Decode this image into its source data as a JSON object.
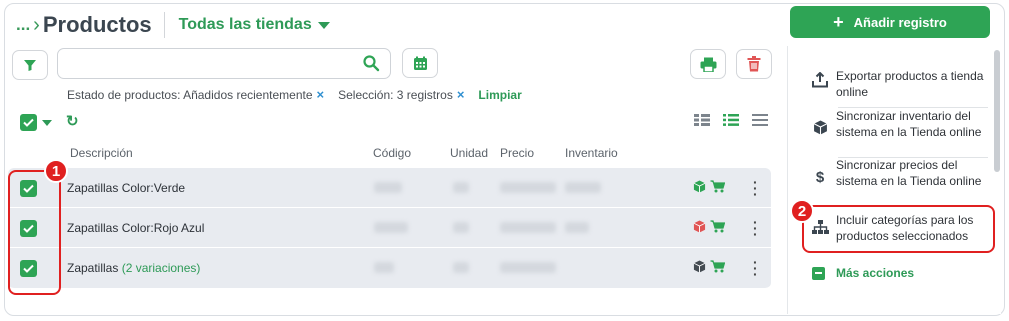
{
  "header": {
    "breadcrumb_ellipsis": "...",
    "title": "Productos",
    "store_selector": "Todas las tiendas",
    "add_button": "Añadir registro"
  },
  "filters": {
    "search_placeholder": "",
    "chips": [
      {
        "label": "Estado de productos: Añadidos recientemente",
        "remove": "×"
      },
      {
        "label": "Selección: 3 registros",
        "remove": "×"
      }
    ],
    "clear_label": "Limpiar"
  },
  "table": {
    "columns": [
      "Descripción",
      "Código",
      "Unidad",
      "Precio",
      "Inventario"
    ],
    "rows": [
      {
        "checked": true,
        "description": "Zapatillas Color:Verde",
        "variations": "",
        "cube_color": "#2ea455"
      },
      {
        "checked": true,
        "description": "Zapatillas Color:Rojo Azul",
        "variations": "",
        "cube_color": "#e05555"
      },
      {
        "checked": true,
        "description": "Zapatillas",
        "variations": "(2 variaciones)",
        "cube_color": "#444b52"
      }
    ]
  },
  "actions_panel": {
    "items": [
      {
        "icon": "export-icon",
        "label": "Exportar productos a tienda online"
      },
      {
        "icon": "cube-icon",
        "label": "Sincronizar inventario del sistema en la Tienda online"
      },
      {
        "icon": "dollar-icon",
        "label": "Sincronizar precios del sistema en la Tienda online"
      },
      {
        "icon": "hierarchy-icon",
        "label": "Incluir categorías para los productos seleccionados"
      }
    ],
    "more_actions": "Más acciones"
  },
  "annotations": {
    "badge_1": "1",
    "badge_2": "2"
  },
  "colors": {
    "accent": "#2ea455",
    "highlight": "#e02020",
    "delete": "#e05555"
  }
}
